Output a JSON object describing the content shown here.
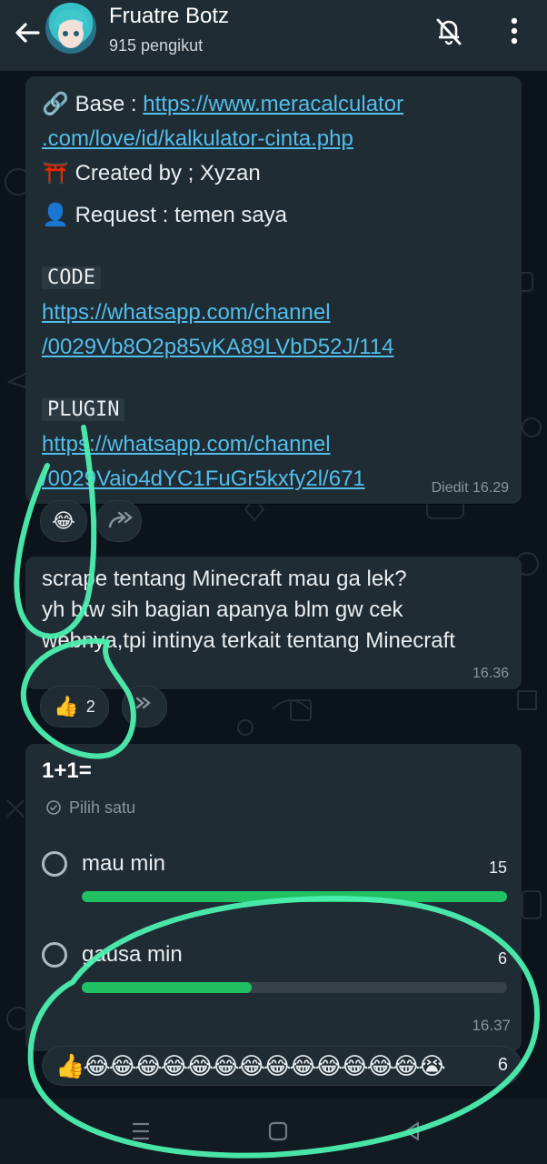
{
  "header": {
    "title": "Fruatre Botz",
    "subtitle": "915 pengikut",
    "icons": [
      "back-arrow-icon",
      "mute-bell-icon",
      "more-vertical-icon"
    ]
  },
  "message1": {
    "base_emoji": "🔗",
    "base_label": "Base : ",
    "base_link_line1": "https://www.meracalculator",
    "base_link_line2": ".com/love/id/kalkulator-cinta.php",
    "created_emoji": "⛩️",
    "created_text": "Created by ; Xyzan",
    "request_emoji": "👤",
    "request_text": "Request : temen saya",
    "code_label": "CODE",
    "code_link_line1": "https://whatsapp.com/channel",
    "code_link_line2": "/0029Vb8O2p85vKA89LVbD52J/114",
    "plugin_label": "PLUGIN",
    "plugin_link_line1": "https://whatsapp.com/channel",
    "plugin_link_line2": "/0029Vaio4dYC1FuGr5kxfy2l/671",
    "meta": "Diedit 16.29",
    "reaction": "😂"
  },
  "message2": {
    "line1": "scrape tentang Minecraft mau ga lek?",
    "line2": "yh btw sih bagian apanya blm gw cek",
    "line3": "webnya,tpi intinya terkait tentang Minecraft",
    "time": "16.36",
    "reaction_emoji": "👍",
    "reaction_count": "2"
  },
  "poll": {
    "question": "1+1=",
    "hint": "Pilih satu",
    "options": [
      {
        "label": "mau min",
        "count": "15",
        "fraction": 1.0
      },
      {
        "label": "gausa min",
        "count": "6",
        "fraction": 0.4
      }
    ],
    "time": "16.37",
    "reactions": "👍😂😂😂😂😂😂😂😂😂😂😂😂😂😭",
    "reactions_count": "6"
  },
  "colors": {
    "accent": "#21c063",
    "link": "#53bdeb",
    "bubble": "#1f2c33",
    "annotation": "#4df0b0"
  },
  "navbar": {
    "icons": [
      "menu-icon",
      "home-icon",
      "back-triangle-icon"
    ]
  }
}
